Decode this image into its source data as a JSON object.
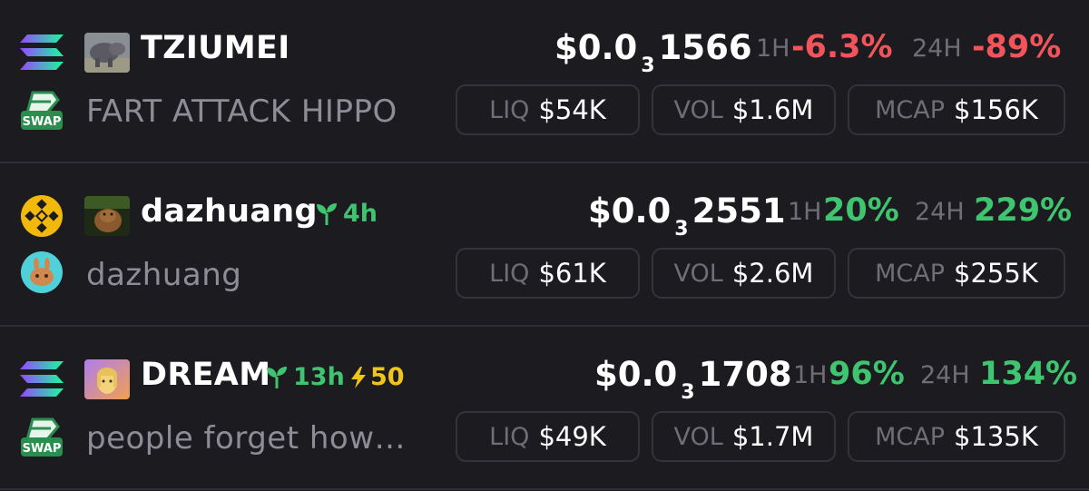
{
  "rows": [
    {
      "symbol": "TZIUMEI",
      "name": "FART ATTACK HIPPO",
      "chain_icon": "solana-icon",
      "dex_icon": "swap-icon",
      "dex_label": "SWAP",
      "price_prefix": "$0.0",
      "price_zeros": "3",
      "price_digits": "1566",
      "tf1": "1H",
      "change_1h": "-6.3%",
      "tf24": "24H",
      "change_24h": "-89%",
      "liq_label": "LIQ",
      "liq": "$54K",
      "vol_label": "VOL",
      "vol": "$1.6M",
      "mcap_label": "MCAP",
      "mcap": "$156K"
    },
    {
      "symbol": "dazhuang",
      "age": "4h",
      "name": "dazhuang",
      "chain_icon": "bnb-icon",
      "dex_icon": "pancakeswap-icon",
      "price_prefix": "$0.0",
      "price_zeros": "3",
      "price_digits": "2551",
      "tf1": "1H",
      "change_1h": "20%",
      "tf24": "24H",
      "change_24h": "229%",
      "liq_label": "LIQ",
      "liq": "$61K",
      "vol_label": "VOL",
      "vol": "$2.6M",
      "mcap_label": "MCAP",
      "mcap": "$255K"
    },
    {
      "symbol": "DREAM",
      "age": "13h",
      "boost": "50",
      "name": "people forget how…",
      "chain_icon": "solana-icon",
      "dex_icon": "swap-icon",
      "dex_label": "SWAP",
      "price_prefix": "$0.0",
      "price_zeros": "3",
      "price_digits": "1708",
      "tf1": "1H",
      "change_1h": "96%",
      "tf24": "24H",
      "change_24h": "134%",
      "liq_label": "LIQ",
      "liq": "$49K",
      "vol_label": "VOL",
      "vol": "$1.7M",
      "mcap_label": "MCAP",
      "mcap": "$135K"
    }
  ],
  "colors": {
    "background": "#1c1b20",
    "positive": "#3fc46f",
    "negative": "#f2545b",
    "boost": "#f0c419",
    "muted": "#8e8c96"
  }
}
